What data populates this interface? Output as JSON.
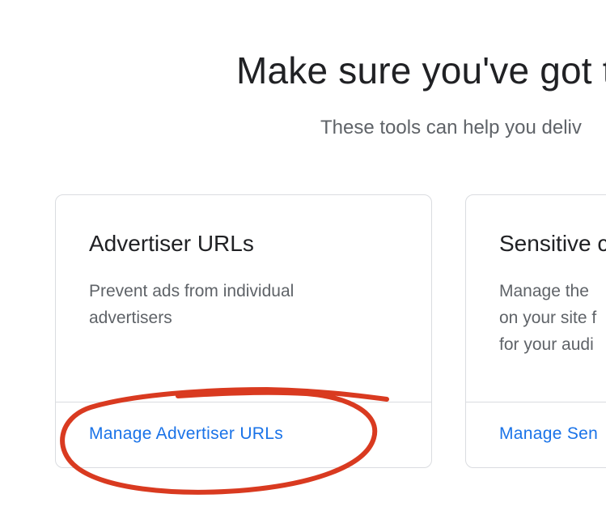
{
  "header": {
    "headline": "Make sure you've got t",
    "subhead": "These tools can help you deliv"
  },
  "cards": [
    {
      "title": "Advertiser URLs",
      "description": "Prevent ads from individual advertisers",
      "link": "Manage Advertiser URLs"
    },
    {
      "title": "Sensitive c",
      "description_lines": [
        "Manage the",
        "on your site f",
        "for your audi"
      ],
      "link": "Manage Sen"
    }
  ],
  "annotation": {
    "color": "#d93a20"
  }
}
